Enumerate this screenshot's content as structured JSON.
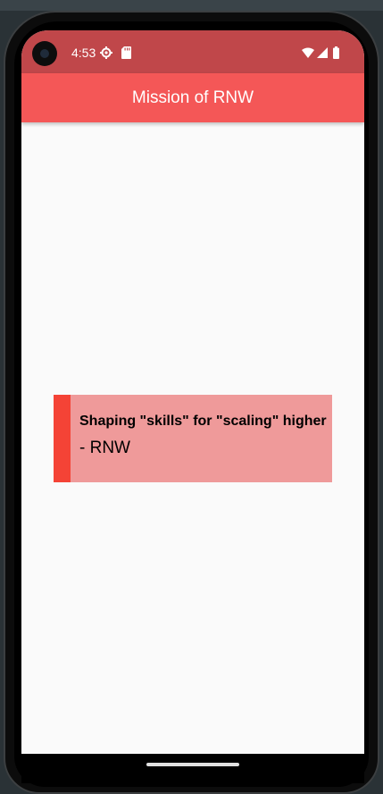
{
  "status_bar": {
    "time": "4:53",
    "icons": [
      "gear-icon",
      "sd-card-icon",
      "wifi-icon",
      "signal-icon",
      "battery-icon"
    ]
  },
  "app_bar": {
    "title": "Mission of RNW",
    "color": "#f45757"
  },
  "quote": {
    "text": "Shaping \"skills\" for \"scaling\" higher",
    "author": "- RNW",
    "background": "#ef9a9a",
    "accent": "#f44336"
  }
}
